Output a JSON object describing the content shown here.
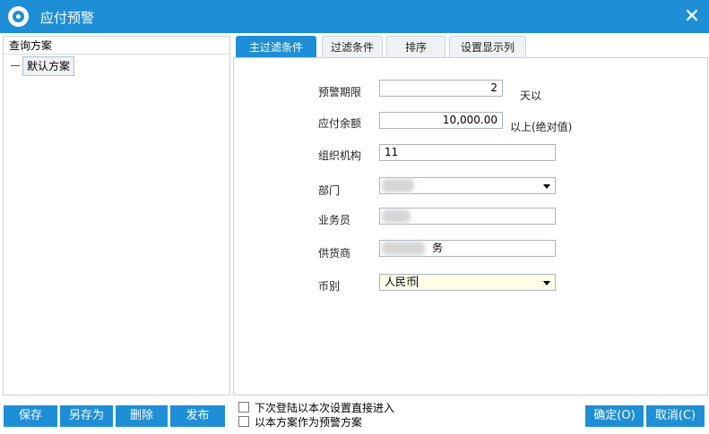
{
  "window": {
    "title": "应付预警",
    "close_glyph": "✕"
  },
  "left_panel": {
    "header": "查询方案",
    "items": [
      {
        "label": "默认方案"
      }
    ]
  },
  "tabs": [
    {
      "label": "主过滤条件",
      "active": true
    },
    {
      "label": "过滤条件",
      "active": false
    },
    {
      "label": "排序",
      "active": false
    },
    {
      "label": "设置显示列",
      "active": false
    }
  ],
  "form": {
    "warning_period": {
      "label": "预警期限",
      "value": "2",
      "suffix": "天以"
    },
    "payable_balance": {
      "label": "应付余额",
      "value": "10,000.00",
      "suffix": "以上(绝对值)"
    },
    "organization": {
      "label": "组织机构",
      "value": "11"
    },
    "department": {
      "label": "部门",
      "value": ""
    },
    "salesperson": {
      "label": "业务员",
      "value": ""
    },
    "supplier": {
      "label": "供货商",
      "value_tail": "务"
    },
    "currency": {
      "label": "币别",
      "value": "人民币"
    }
  },
  "buttons": {
    "save": "保存",
    "save_as": "另存为",
    "delete": "删除",
    "publish": "发布",
    "ok": "确定(O)",
    "cancel": "取消(C)"
  },
  "checkboxes": {
    "enter_directly": {
      "label": "下次登陆以本次设置直接进入",
      "checked": false
    },
    "use_as_warning_scheme": {
      "label": "以本方案作为预警方案",
      "checked": false
    }
  },
  "colors": {
    "accent": "#1e8fd6",
    "highlight_field": "#fdfde8"
  }
}
